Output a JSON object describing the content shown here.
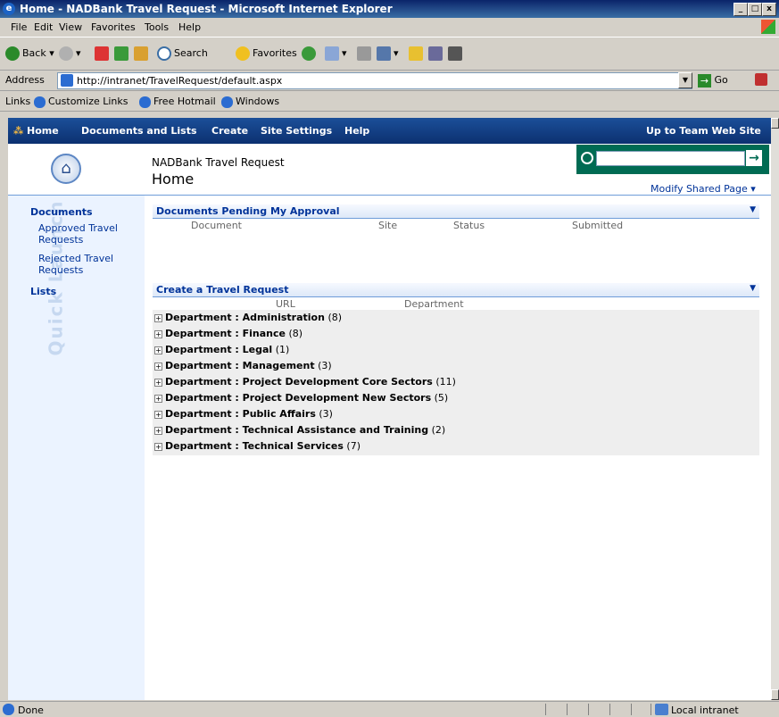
{
  "window": {
    "title": "Home - NADBank Travel Request - Microsoft Internet Explorer"
  },
  "menu": [
    "File",
    "Edit",
    "View",
    "Favorites",
    "Tools",
    "Help"
  ],
  "toolbar": {
    "back": "Back",
    "search": "Search",
    "favorites": "Favorites"
  },
  "address": {
    "label": "Address",
    "url": "http://intranet/TravelRequest/default.aspx",
    "go": "Go"
  },
  "links": {
    "label": "Links",
    "items": [
      "Customize Links",
      "Free Hotmail",
      "Windows"
    ]
  },
  "topnav": {
    "items": [
      "Home",
      "Documents and Lists",
      "Create",
      "Site Settings",
      "Help"
    ],
    "right": "Up to Team Web Site"
  },
  "header": {
    "site_name": "NADBank Travel Request",
    "page_title": "Home",
    "modify": "Modify Shared Page"
  },
  "quick_launch": {
    "watermark": "Quick Launch",
    "documents": "Documents",
    "doc_links": [
      "Approved Travel Requests",
      "Rejected Travel Requests"
    ],
    "lists": "Lists"
  },
  "pending": {
    "title": "Documents Pending My Approval",
    "columns": [
      "Document",
      "Site",
      "Status",
      "Submitted"
    ]
  },
  "create": {
    "title": "Create a Travel Request",
    "columns": [
      "URL",
      "Department"
    ],
    "groups": [
      {
        "label": "Department : Administration",
        "count": "(8)"
      },
      {
        "label": "Department : Finance",
        "count": "(8)"
      },
      {
        "label": "Department : Legal",
        "count": "(1)"
      },
      {
        "label": "Department : Management",
        "count": "(3)"
      },
      {
        "label": "Department : Project Development Core Sectors",
        "count": "(11)"
      },
      {
        "label": "Department : Project Development New Sectors",
        "count": "(5)"
      },
      {
        "label": "Department : Public Affairs",
        "count": "(3)"
      },
      {
        "label": "Department : Technical Assistance and Training",
        "count": "(2)"
      },
      {
        "label": "Department : Technical Services",
        "count": "(7)"
      }
    ]
  },
  "status": {
    "text": "Done",
    "zone": "Local intranet"
  },
  "colors": {
    "nav": "#0c3070",
    "accent": "#003399",
    "search": "#006b53",
    "quicklaunch": "#ebf3ff"
  }
}
